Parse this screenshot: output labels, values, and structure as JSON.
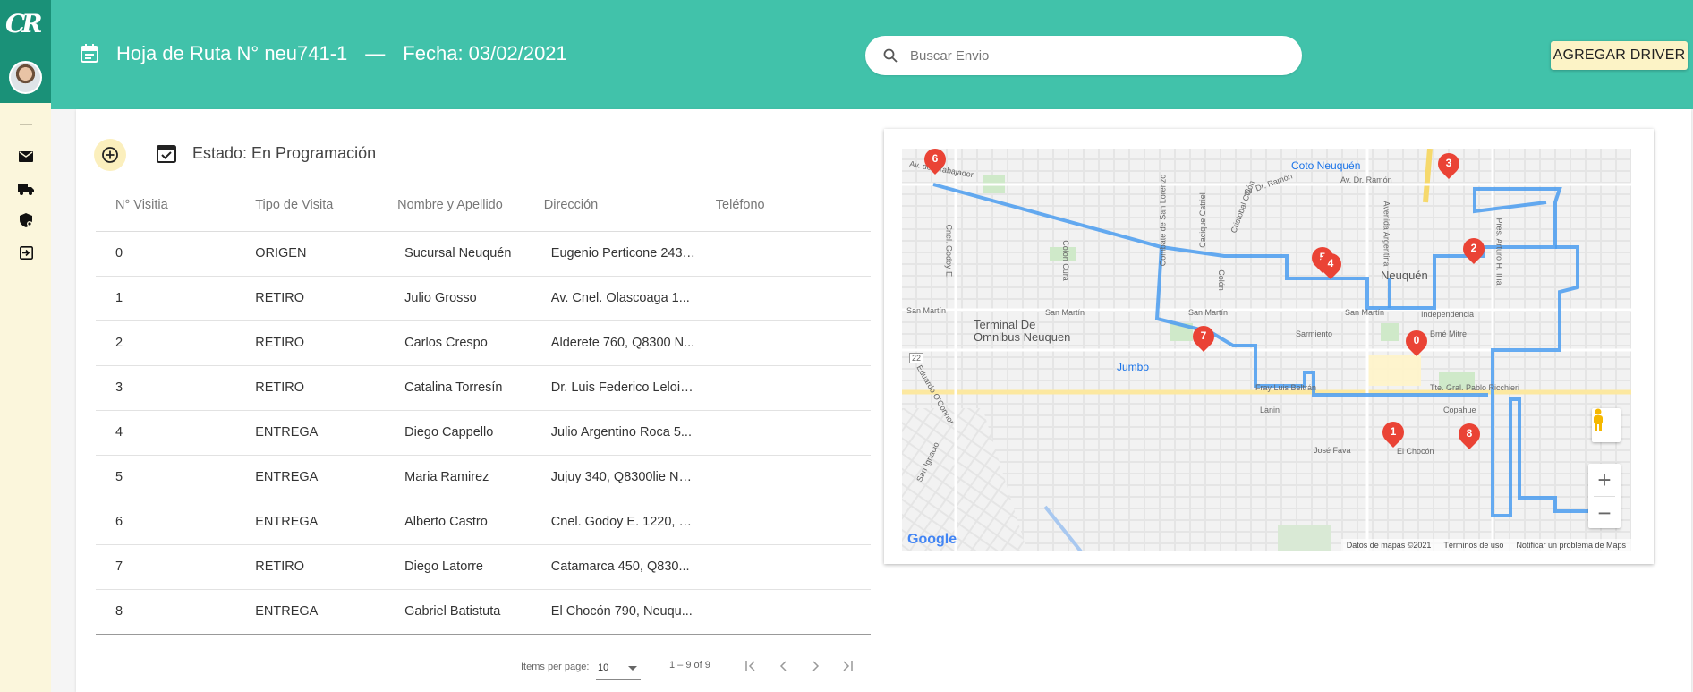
{
  "header": {
    "title": "Hoja de Ruta N° neu741-1",
    "separator": "—",
    "date": "Fecha: 03/02/2021",
    "search_placeholder": "Buscar Envio",
    "add_driver": "AGREGAR DRIVER"
  },
  "status": {
    "label": "Estado: En Programación"
  },
  "table": {
    "columns": [
      "N° Visitia",
      "Tipo de Visita",
      "Nombre y Apellido",
      "Dirección",
      "Teléfono"
    ],
    "rows": [
      [
        "0",
        "ORIGEN",
        "Sucursal Neuquén",
        "Eugenio Perticone 243,...",
        ""
      ],
      [
        "1",
        "RETIRO",
        "Julio Grosso",
        "Av. Cnel. Olascoaga 1...",
        ""
      ],
      [
        "2",
        "RETIRO",
        "Carlos Crespo",
        "Alderete 760, Q8300 N...",
        ""
      ],
      [
        "3",
        "RETIRO",
        "Catalina Torresín",
        "Dr. Luis Federico Leloir ...",
        ""
      ],
      [
        "4",
        "ENTREGA",
        "Diego Cappello",
        "Julio Argentino Roca 5...",
        ""
      ],
      [
        "5",
        "ENTREGA",
        "Maria Ramirez",
        "Jujuy 340, Q8300lie Ne...",
        ""
      ],
      [
        "6",
        "ENTREGA",
        "Alberto Castro",
        "Cnel. Godoy E. 1220, Q...",
        ""
      ],
      [
        "7",
        "RETIRO",
        "Diego Latorre",
        "Catamarca 450, Q830...",
        ""
      ],
      [
        "8",
        "ENTREGA",
        "Gabriel Batistuta",
        "El Chocón 790, Neuqu...",
        ""
      ]
    ]
  },
  "paginator": {
    "items_per_page_label": "Items per page:",
    "items_per_page_value": "10",
    "range": "1 – 9 of 9"
  },
  "map": {
    "street_labels": [
      "Av. del Trabajador",
      "Cnel. Godoy E.",
      "Colon Cura",
      "Combate de San Lorenzo",
      "Cacique Catriel",
      "Cristobal Colón",
      "Av. Dr. Ramón",
      "Av. Dr. Ramón",
      "San Martín",
      "San Martín",
      "San Martín",
      "San Martín",
      "Sarmiento",
      "Fray Luis Beltrán",
      "Lanin",
      "José Fava",
      "El Chocón",
      "Eduardo O'Connor",
      "San Ignacio",
      "Independencia",
      "Tte. Gral. Pablo Ricchieri",
      "Copahue",
      "Avenida Argentina",
      "Pres. Arturo H. Illia",
      "Bmé Mitre",
      "Colón"
    ],
    "place_labels": [
      "Coto Neuquén",
      "Terminal De Omnibus Neuquen",
      "Jumbo"
    ],
    "city_label": "Neuquén",
    "route_shield": "22",
    "markers": [
      "6",
      "3",
      "2",
      "5",
      "4",
      "7",
      "0",
      "1",
      "8"
    ],
    "google_text": "Google",
    "footer": [
      "Datos de mapas ©2021",
      "Términos de uso",
      "Notificar un problema de Maps"
    ],
    "zoom_in": "+",
    "zoom_out": "−"
  }
}
